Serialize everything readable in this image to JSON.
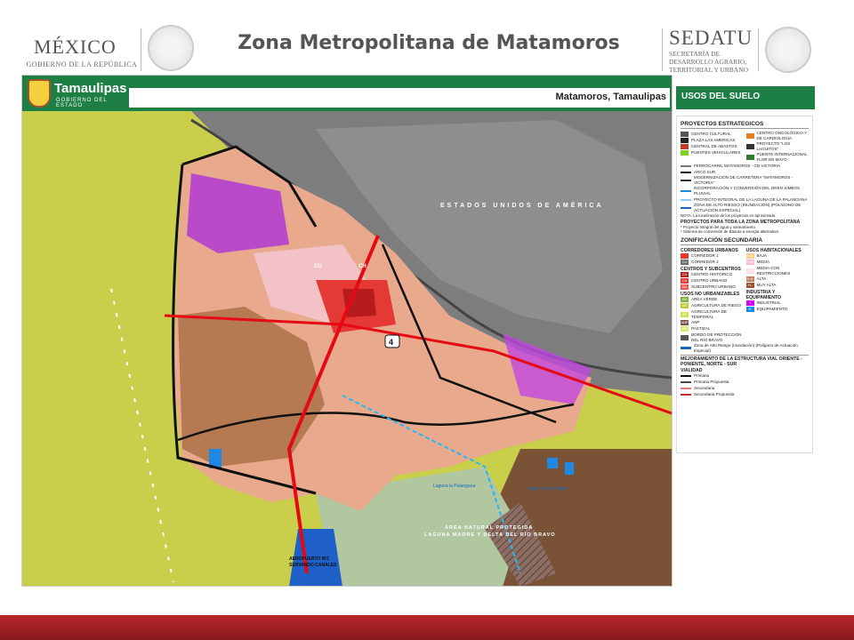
{
  "header": {
    "title": "Zona Metropolitana de Matamoros",
    "logo_left_name": "MÉXICO",
    "logo_left_sub": "GOBIERNO DE LA REPÚBLICA",
    "logo_right_name": "SEDATU",
    "logo_right_sub_1": "SECRETARÍA DE",
    "logo_right_sub_2": "DESARROLLO AGRARIO,",
    "logo_right_sub_3": "TERRITORIAL Y URBANO"
  },
  "map": {
    "band_logo_name": "Tamaulipas",
    "band_logo_sub": "GOBIERNO DEL ESTADO",
    "band_city": "Matamoros, Tamaulipas",
    "labels": {
      "country": "ESTADOS UNIDOS DE AMÉRICA",
      "reserve_1": "ÁREA NATURAL PROTEGIDA",
      "reserve_2": "LAGUNA MADRE Y DELTA DEL RÍO BRAVO",
      "airport_1": "AEROPUERTO INT.",
      "airport_2": "SERVANDO CANALES",
      "lagoon_1": "Laguna la Palangana",
      "lagoon_2": "Laguna Lisas Salida",
      "road_shield": "4",
      "cu": "CU",
      "ch": "CH"
    }
  },
  "legend": {
    "heading": "USOS DEL SUELO",
    "proyectos_title": "PROYECTOS ESTRATEGICOS",
    "proyectos": [
      {
        "label": "CENTRO CULTURAL",
        "color": "#555555"
      },
      {
        "label": "PLAZA LAS AMERICAS",
        "color": "#222222"
      },
      {
        "label": "CENTRAL DE ABASTOS",
        "color": "#c0392b"
      },
      {
        "label": "PUENTES VEHICULARES",
        "color": "#7ed321"
      }
    ],
    "proyectos_right": [
      {
        "label": "CENTRO ONCOLÓGICO Y DE CARDIOLOGÍA",
        "color": "#e67e22"
      },
      {
        "label": "PROYECTO \"LOS LAGUITOS\"",
        "color": "#333333"
      },
      {
        "label": "PUENTE INTERNACIONAL FLOR DE MAYO",
        "color": "#2e7d32"
      }
    ],
    "lineas": [
      {
        "label": "FERROCARRIL MATAMOROS - CD VICTORIA",
        "color": "#777777"
      },
      {
        "label": "ARCO SUR",
        "color": "#111111"
      },
      {
        "label": "MODERNIZACIÓN DE CARRETERA \"MATAMOROS - VICTORIA\"",
        "color": "#333333"
      },
      {
        "label": "INCORPORACIÓN Y CONVERSIÓN DEL DREN SIMBOS PLUVIAL",
        "color": "#1e88e5"
      },
      {
        "label": "PROYECTO INTEGRAL DE LA LAGUNA DE LA PALANGANA",
        "color": "#90caf9"
      },
      {
        "label": "ZONA DE ALTO RIESGO (INUNDACIÓN) (POLÍGONO DE ACTUACIÓN ESPECIAL)",
        "color": "#1565c0"
      }
    ],
    "nota": "NOTA: La localización de los proyectos es aproximada",
    "zona_title": "PROYECTOS PARA TODA LA ZONA METROPOLITANA",
    "zona_items": [
      "* Proyecto Integral del agua y saneamiento",
      "* Sistema de conversión de Basura a energía alternativa"
    ],
    "zonificacion_title": "ZONIFICACIÓN SECUNDARIA",
    "corredores_title": "CORREDORES URBANOS",
    "corredores": [
      {
        "code": "",
        "label": "CORREDOR 1",
        "color": "#e53935"
      },
      {
        "code": "CU",
        "label": "CORREDOR 2",
        "color": "#6d6d6d"
      }
    ],
    "centros_title": "CENTROS Y SUBCENTROS",
    "centros": [
      {
        "code": "CH",
        "label": "CENTRO HISTÓRICO",
        "color": "#b71c1c"
      },
      {
        "code": "CU",
        "label": "CENTRO URBANO",
        "color": "#e53935"
      },
      {
        "code": "SU",
        "label": "SUBCENTRO URBANO",
        "color": "#ef5350"
      }
    ],
    "habitacionales_title": "USOS HABITACIONALES",
    "habitacionales": [
      {
        "code": "H-B",
        "label": "BAJA",
        "color": "#ffcc80"
      },
      {
        "code": "H-M",
        "label": "MEDIA",
        "color": "#f8bbd0"
      },
      {
        "code": "H-MR",
        "label": "MEDIA CON RESTRICCIONES",
        "color": "#fce4ec"
      },
      {
        "code": "H-A",
        "label": "ALTA",
        "color": "#c08060"
      },
      {
        "code": "H-MA",
        "label": "MUY ALTA",
        "color": "#a0522d"
      }
    ],
    "no_urbanizables_title": "USOS NO URBANIZABLES",
    "no_urbanizables": [
      {
        "code": "AV",
        "label": "AREA VERDE",
        "color": "#7cb342"
      },
      {
        "code": "AR",
        "label": "AGRICULTURA DE RIEGO",
        "color": "#c0ca33"
      },
      {
        "code": "AT",
        "label": "AGRICULTURA DE TEMPORAL",
        "color": "#d4e157"
      },
      {
        "code": "ANP",
        "label": "ANP",
        "color": "#795548"
      },
      {
        "code": "PZ",
        "label": "PASTIZAL",
        "color": "#dce775"
      },
      {
        "code": "",
        "label": "BORDO DE PROTECCIÓN DEL RÍO BRAVO",
        "color": "#555555"
      }
    ],
    "industria_title": "INDUSTRIA Y EQUIPAMIENTO",
    "industria": [
      {
        "code": "I",
        "label": "INDUSTRIAL",
        "color": "#d500f9"
      },
      {
        "code": "E",
        "label": "EQUIPAMIENTO",
        "color": "#1e88e5"
      }
    ],
    "alto_riesgo": "Zona de Alto Riesgo (Inundación) (Polígono de Actuación Especial)",
    "mejoramiento_title": "MEJORAMIENTO DE LA ESTRUCTURA VIAL ORIENTE - PONIENTE, NORTE - SUR",
    "vialidad_title": "VIALIDAD",
    "vialidad": [
      {
        "label": "Primaria",
        "color": "#111111"
      },
      {
        "label": "Primaria Propuesta",
        "color": "#444444"
      },
      {
        "label": "Secundaria",
        "color": "#e57373"
      },
      {
        "label": "Secundaria Propuesta",
        "color": "#c62828"
      }
    ]
  },
  "colors": {
    "accent_green": "#1d7f43",
    "footer_red": "#b8272b"
  }
}
